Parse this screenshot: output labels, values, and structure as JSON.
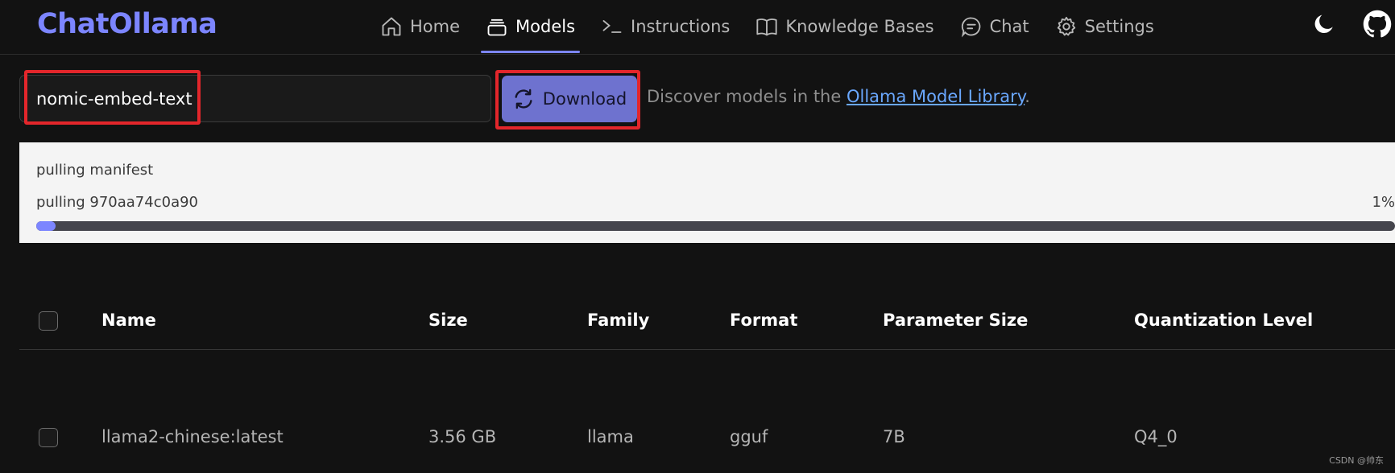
{
  "app": {
    "title": "ChatOllama"
  },
  "nav": [
    {
      "label": "Home",
      "icon": "home-icon",
      "active": false
    },
    {
      "label": "Models",
      "icon": "models-icon",
      "active": true
    },
    {
      "label": "Instructions",
      "icon": "terminal-icon",
      "active": false
    },
    {
      "label": "Knowledge Bases",
      "icon": "book-icon",
      "active": false
    },
    {
      "label": "Chat",
      "icon": "chat-icon",
      "active": false
    },
    {
      "label": "Settings",
      "icon": "gear-icon",
      "active": false
    }
  ],
  "header_icons": [
    "moon-icon",
    "github-icon"
  ],
  "download": {
    "input_value": "nomic-embed-text",
    "button_label": "Download",
    "button_icon": "refresh-icon",
    "hint_prefix": "Discover models in the ",
    "hint_link": "Ollama Model Library",
    "hint_suffix": "."
  },
  "progress": {
    "line1": "pulling manifest",
    "line2": "pulling 970aa74c0a90",
    "percent_label": "1%",
    "percent_value": 1
  },
  "table": {
    "headers": [
      "Name",
      "Size",
      "Family",
      "Format",
      "Parameter Size",
      "Quantization Level"
    ],
    "rows": [
      {
        "name": "llama2-chinese:latest",
        "size": "3.56 GB",
        "family": "llama",
        "format": "gguf",
        "parameter_size": "7B",
        "quantization": "Q4_0"
      }
    ]
  },
  "watermark": "CSDN @帅东",
  "colors": {
    "accent": "#7c85ff",
    "button": "#6e72cf",
    "highlight": "#e3262b",
    "link": "#6aa8ff",
    "background": "#121212"
  }
}
